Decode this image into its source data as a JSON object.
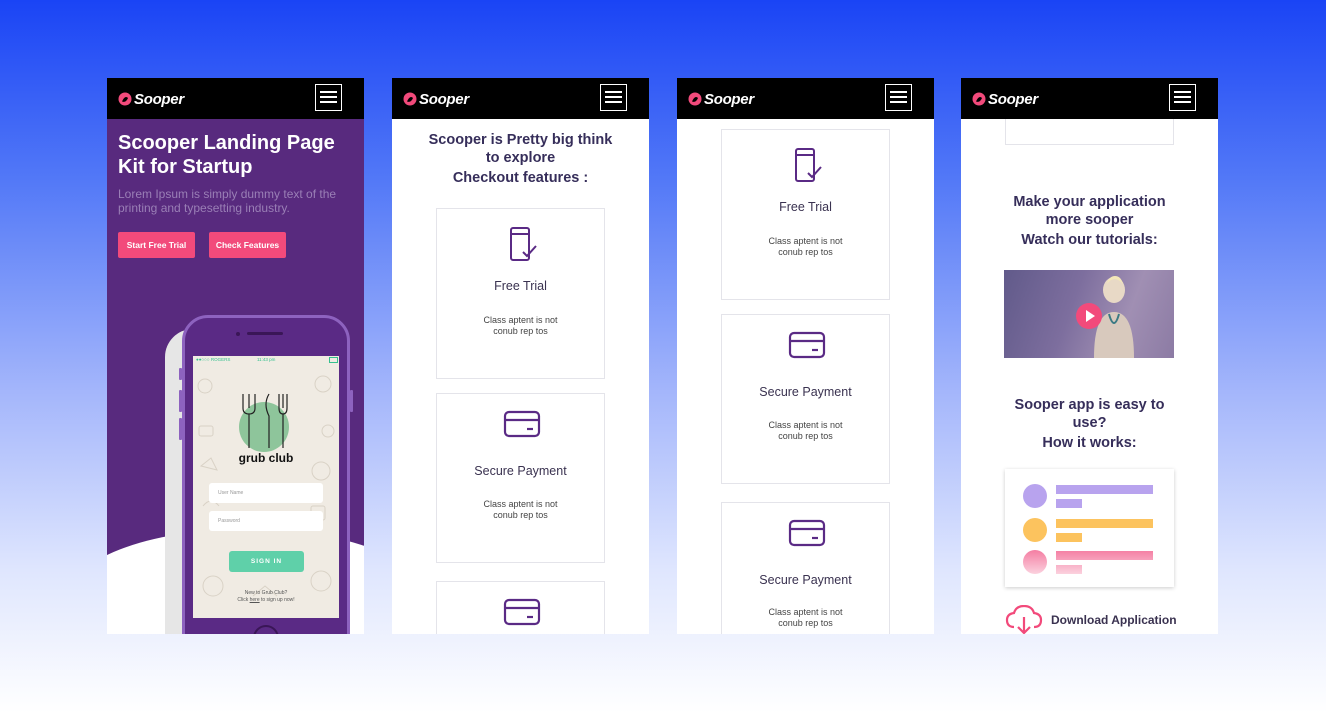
{
  "brand": {
    "name": "Sooper",
    "accent": "#f24a7b",
    "purple": "#582a7e",
    "topbar": "#000000"
  },
  "screen1": {
    "hero_title": "Scooper Landing Page Kit for Startup",
    "hero_subtitle": "Lorem Ipsum is simply dummy text of the printing and typesetting industry.",
    "btn_trial": "Start Free Trial",
    "btn_features": "Check Features",
    "phone": {
      "carrier": "●●○○○ ROGERS",
      "time": "11:43 pm",
      "app_name": "grub club",
      "username_placeholder": "User Name",
      "password_placeholder": "Password",
      "signin": "SIGN IN",
      "note_line1": "New to Grub Club?",
      "note_line2_pre": "Click ",
      "note_link": "here",
      "note_line2_post": " to sign up now!"
    }
  },
  "screen2": {
    "heading_l1": "Scooper is Pretty big think",
    "heading_l2": "to explore",
    "heading_l3": "Checkout features :",
    "cards": [
      {
        "title": "Free Trial",
        "text_l1": "Class aptent is not",
        "text_l2": "conub rep tos",
        "icon": "mobile-check-icon"
      },
      {
        "title": "Secure Payment",
        "text_l1": "Class aptent is not",
        "text_l2": "conub rep tos",
        "icon": "credit-card-icon"
      },
      {
        "title": "",
        "icon": "credit-card-icon"
      }
    ]
  },
  "screen3": {
    "cards": [
      {
        "title": "Free Trial",
        "text_l1": "Class aptent is not",
        "text_l2": "conub rep tos",
        "icon": "mobile-check-icon"
      },
      {
        "title": "Secure Payment",
        "text_l1": "Class aptent is not",
        "text_l2": "conub rep tos",
        "icon": "credit-card-icon"
      },
      {
        "title": "Secure Payment",
        "text_l1": "Class aptent is not",
        "text_l2": "conub rep tos",
        "icon": "credit-card-icon"
      }
    ]
  },
  "screen4": {
    "tutorial_l1": "Make your application",
    "tutorial_l2": "more sooper",
    "tutorial_l3": "Watch our tutorials:",
    "how_l1": "Sooper app is easy to",
    "how_l2": "use?",
    "how_l3": "How it works:",
    "download": "Download Application",
    "how_colors": [
      "#b8a3ee",
      "#fcc35e",
      "#f47aa0"
    ]
  }
}
